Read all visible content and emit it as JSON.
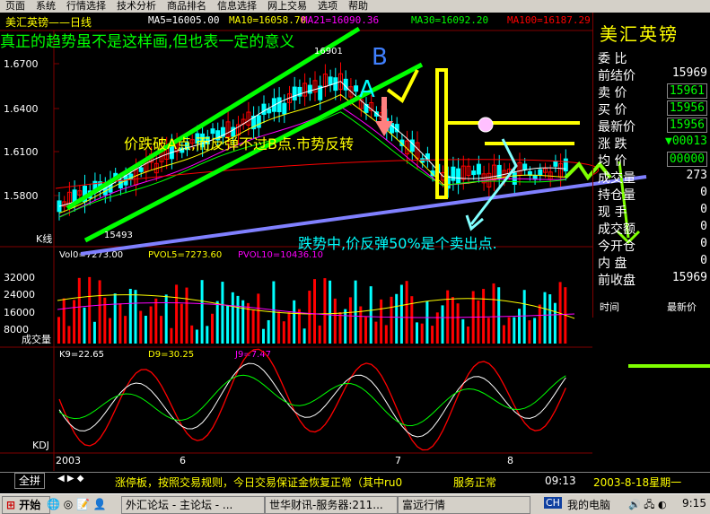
{
  "menu": [
    "页面",
    "系统",
    "行情选择",
    "技术分析",
    "商品排名",
    "信息选择",
    "网上交易",
    "选项",
    "帮助"
  ],
  "chart_title": "美汇英镑——日线",
  "ma_labels": [
    {
      "text": "MA5=16005.00",
      "color": "#ffffff"
    },
    {
      "text": "MA10=16058.70",
      "color": "#ffff00"
    },
    {
      "text": "MA21=16090.36",
      "color": "#ff00ff"
    },
    {
      "text": "MA30=16092.20",
      "color": "#00ff00"
    },
    {
      "text": "MA100=16187.29",
      "color": "#ff0000"
    }
  ],
  "annotations": {
    "top_note": "真正的趋势虽不是这样画,但也表一定的意义",
    "middle_note": "价跌破A点,而反弹不过B点.市势反转",
    "lower_note": "跌势中,价反弹50%是个卖出点.",
    "label_a": "A",
    "label_b": "B",
    "k_label": "K线",
    "low_label": "15493",
    "high_label": "16901"
  },
  "price_axis": [
    "1.6700",
    "1.6400",
    "1.6100",
    "1.5800"
  ],
  "vol_axis": [
    "32000",
    "24000",
    "16000",
    "8000"
  ],
  "vol_label": "成交量",
  "vol_header": {
    "vol": "Vol0=7273.00",
    "pvol5": "PVOL5=7273.60",
    "pvol10": "PVOL10=10436.10"
  },
  "kdj_header": {
    "k": "K9=22.65",
    "d": "D9=30.25",
    "j": "J9=7.47"
  },
  "kdj_label": "KDJ",
  "x_axis": [
    "2003",
    "6",
    "7",
    "8"
  ],
  "right_panel": {
    "title": "美汇英镑",
    "rows": [
      {
        "label": "委  比",
        "value": "",
        "color": "#ffffff"
      },
      {
        "label": "前结价",
        "value": "15969",
        "color": "#ffffff"
      },
      {
        "label": "卖  价",
        "value": "15961",
        "color": "#00ff00"
      },
      {
        "label": "买  价",
        "value": "15956",
        "color": "#00ff00"
      },
      {
        "label": "最新价",
        "value": "15956",
        "color": "#00ff00"
      },
      {
        "label": "涨  跌",
        "value": "▼00013",
        "color": "#00ff00"
      },
      {
        "label": "均  价",
        "value": "00000",
        "color": "#00ff00"
      },
      {
        "label": "成交量",
        "value": "273",
        "color": "#ffffff"
      },
      {
        "label": "持仓量",
        "value": "0",
        "color": "#ffffff"
      },
      {
        "label": "现  手",
        "value": "0",
        "color": "#ffffff"
      },
      {
        "label": "成交额",
        "value": "0",
        "color": "#ffffff"
      },
      {
        "label": "今开仓",
        "value": "0",
        "color": "#ffffff"
      },
      {
        "label": "内  盘",
        "value": "0",
        "color": "#ffffff"
      },
      {
        "label": "前收盘",
        "value": "15969",
        "color": "#ffffff"
      }
    ],
    "col_time": "时间",
    "col_price": "最新价"
  },
  "status": {
    "button": "全拼",
    "ticker": "涨停板，按照交易规则，今日交易保证金恢复正常（其中ru0",
    "ticker_end": "服务正常",
    "time": "09:13",
    "date": "2003-8-18星期一"
  },
  "taskbar": {
    "start": "开始",
    "items": [
      "外汇论坛 - 主论坛 - ...",
      "世华财讯-服务器:211...",
      "富远行情"
    ],
    "my_computer": "我的电脑",
    "lang": "CH",
    "clock": "9:15"
  },
  "colors": {
    "up": "#ff0000",
    "down": "#00ffff",
    "trend": "#00ff00",
    "support": "#8080ff",
    "highlight": "#ffff00"
  }
}
